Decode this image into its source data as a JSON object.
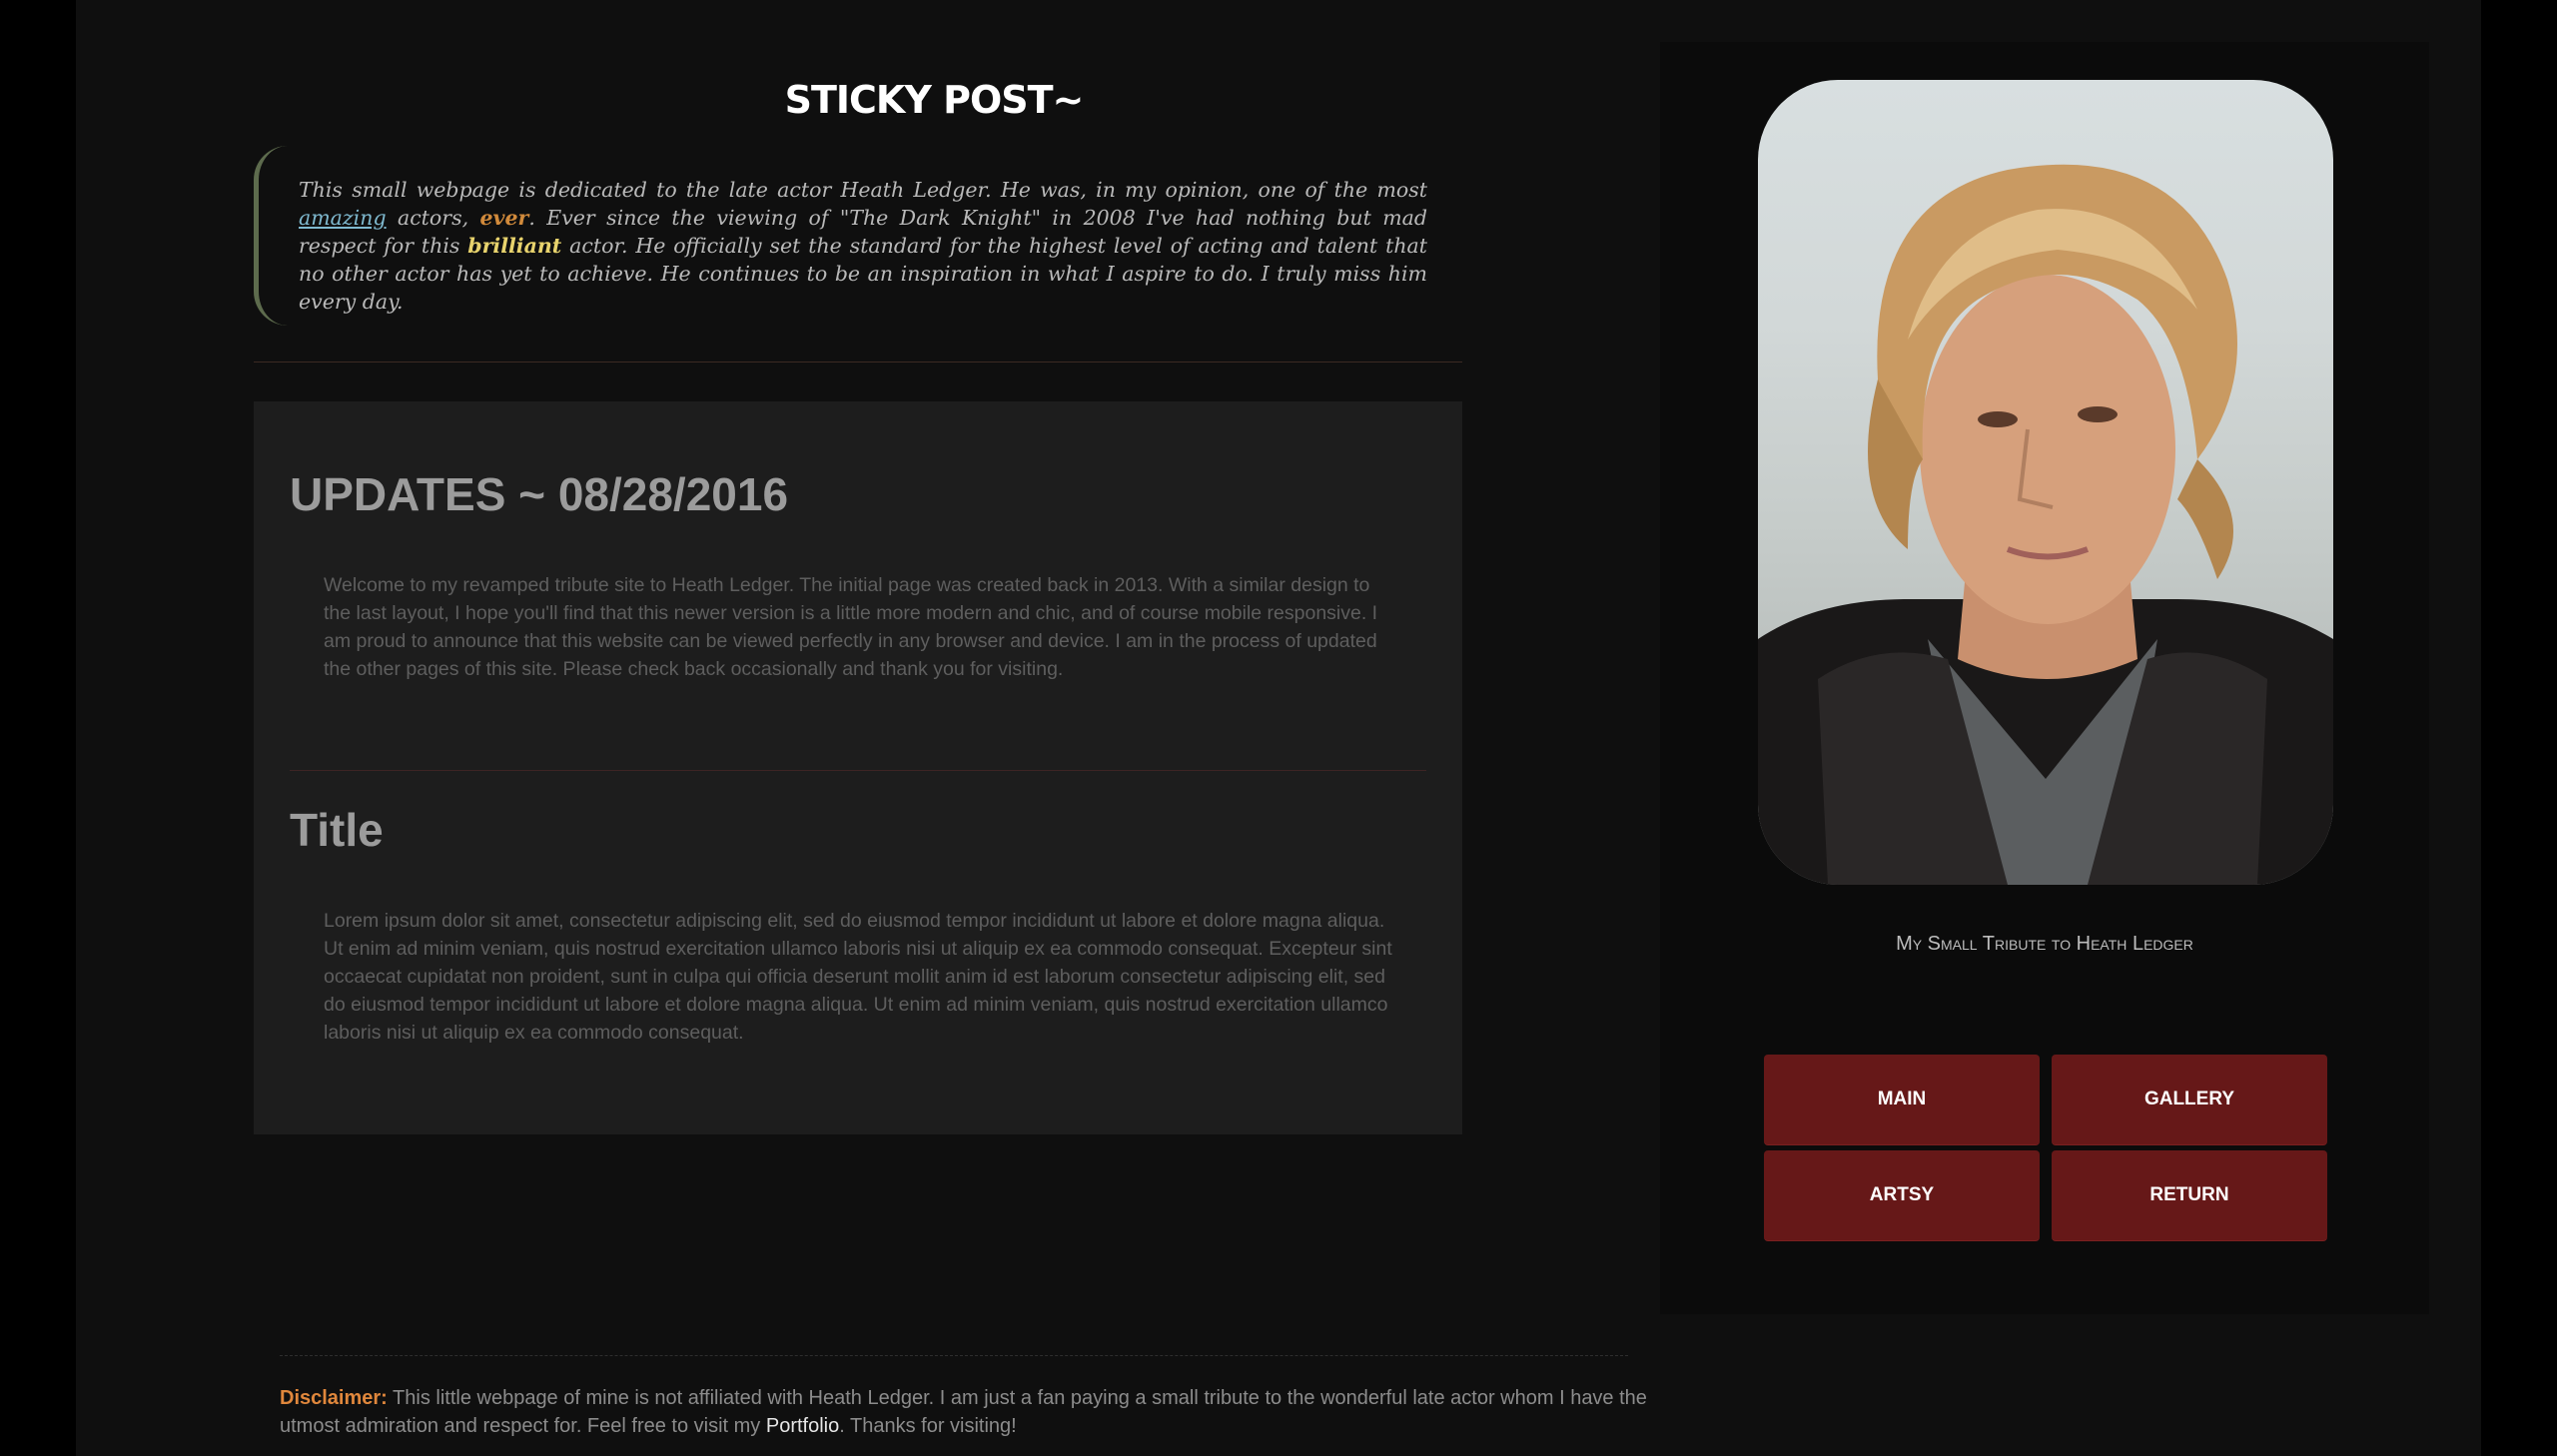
{
  "sticky": {
    "title": "STICKY POST~",
    "quote_part1": "This small webpage is dedicated to the late actor Heath Ledger. He was, in my opinion, one of the most ",
    "amazing": "amazing",
    "quote_part2": " actors, ",
    "ever": "ever",
    "quote_part3": ". Ever since the viewing of \"The Dark Knight\" in 2008 I've had nothing but mad respect for this ",
    "brilliant": "brilliant",
    "quote_part4": " actor. He officially set the standard for the highest level of acting and talent that no other actor has yet to achieve. He continues to be an inspiration in what I aspire to do. I truly miss him every day."
  },
  "updates": {
    "heading": "UPDATES ~ 08/28/2016",
    "body": "Welcome to my revamped tribute site to Heath Ledger. The initial page was created back in 2013. With a similar design to the last layout, I hope you'll find that this newer version is a little more modern and chic, and of course mobile responsive. I am proud to announce that this website can be viewed perfectly in any browser and device. I am in the process of updated the other pages of this site. Please check back occasionally and thank you for visiting."
  },
  "post": {
    "heading": "Title",
    "body": "Lorem ipsum dolor sit amet, consectetur adipiscing elit, sed do eiusmod tempor incididunt ut labore et dolore magna aliqua. Ut enim ad minim veniam, quis nostrud exercitation ullamco laboris nisi ut aliquip ex ea commodo consequat. Excepteur sint occaecat cupidatat non proident, sunt in culpa qui officia deserunt mollit anim id est laborum consectetur adipiscing elit, sed do eiusmod tempor incididunt ut labore et dolore magna aliqua. Ut enim ad minim veniam, quis nostrud exercitation ullamco laboris nisi ut aliquip ex ea commodo consequat."
  },
  "disclaimer": {
    "label": "Disclaimer:",
    "text": " This little webpage of mine is not affiliated with Heath Ledger. I am just a fan paying a small tribute to the wonderful late actor whom I have the utmost admiration and respect for. Feel free to visit my ",
    "portfolio": "Portfolio",
    "end": ". Thanks for visiting!"
  },
  "sidebar": {
    "caption": "My Small Tribute to Heath Ledger",
    "nav": {
      "main": "MAIN",
      "gallery": "GALLERY",
      "artsy": "ARTSY",
      "return": "RETURN"
    }
  },
  "colors": {
    "background": "#0f0f0f",
    "panel": "#1d1d1d",
    "nav_button": "#661818",
    "link": "#7fb9cf",
    "accent_orange": "#e0873c",
    "accent_yellow": "#e8d36d"
  }
}
